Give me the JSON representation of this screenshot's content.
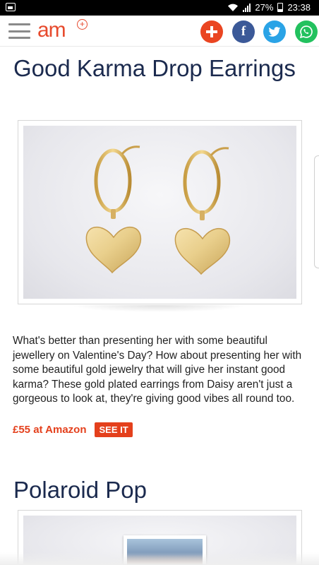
{
  "status_bar": {
    "battery": "27%",
    "time": "23:38"
  },
  "header": {
    "logo_text": "am",
    "logo_badge": "+",
    "share": {
      "add_icon": "plus-icon",
      "facebook_label": "f",
      "twitter_icon": "twitter-bird-icon",
      "whatsapp_icon": "whatsapp-icon"
    }
  },
  "articles": [
    {
      "title": "Good Karma Drop Earrings",
      "image": "gold-heart-drop-earrings",
      "description": "What's better than presenting her with some beautiful jewellery on Valentine's Day? How about presenting her with some beautiful gold jewelry that will give her instant good karma? These gold plated earrings from Daisy aren't just a gorgeous to look at, they're giving good vibes all round too.",
      "price_link": "£55 at Amazon",
      "cta": "SEE IT"
    },
    {
      "title": "Polaroid Pop",
      "image": "polaroid-photo"
    }
  ],
  "colors": {
    "brand": "#e74a2d",
    "title": "#1b2a4e",
    "cta": "#e4401c",
    "facebook": "#3b5998",
    "twitter": "#2aa3e6",
    "whatsapp": "#22c15e"
  }
}
